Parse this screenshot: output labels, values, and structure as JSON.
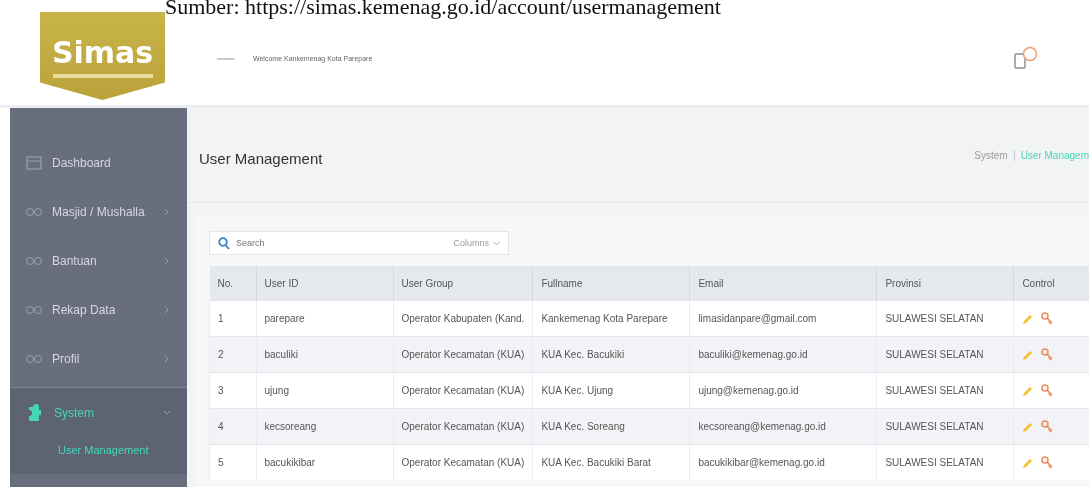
{
  "caption": "Sumber: https://simas.kemenag.go.id/account/usermanagement",
  "logo": {
    "text": "Simas"
  },
  "header": {
    "welcome": "Welcome Kankemenag Kota Parepare"
  },
  "sidebar": {
    "items": [
      {
        "label": "Dashboard",
        "has_children": false,
        "selected": false
      },
      {
        "label": "Masjid / Mushalla",
        "has_children": true,
        "selected": false
      },
      {
        "label": "Bantuan",
        "has_children": true,
        "selected": false
      },
      {
        "label": "Rekap Data",
        "has_children": true,
        "selected": false
      },
      {
        "label": "Profil",
        "has_children": true,
        "selected": false
      },
      {
        "label": "System",
        "has_children": true,
        "selected": true,
        "expanded": true,
        "children": [
          {
            "label": "User Management",
            "selected": true
          }
        ]
      }
    ]
  },
  "page": {
    "title": "User Management",
    "breadcrumb": [
      {
        "label": "System",
        "selected": false
      },
      {
        "label": "User Managem",
        "selected": true
      }
    ]
  },
  "search": {
    "placeholder": "Search"
  },
  "columns_button": "Columns",
  "table": {
    "columns": [
      "No.",
      "User ID",
      "User Group",
      "Fullname",
      "Email",
      "Provinsi",
      "Control"
    ],
    "rows": [
      [
        "1",
        "parepare",
        "Operator Kabupaten (Kand.",
        "Kankemenag Kota Parepare",
        "limasidanpare@gmail.com",
        "SULAWESI SELATAN"
      ],
      [
        "2",
        "baculiki",
        "Operator Kecamatan (KUA)",
        "KUA Kec. Bacukiki",
        "baculiki@kemenag.go.id",
        "SULAWESI SELATAN"
      ],
      [
        "3",
        "ujung",
        "Operator Kecamatan (KUA)",
        "KUA Kec. Ujung",
        "ujung@kemenag.go.id",
        "SULAWESI SELATAN"
      ],
      [
        "4",
        "kecsoreang",
        "Operator Kecamatan (KUA)",
        "KUA Kec. Soreang",
        "kecsoreang@kemenag.go.id",
        "SULAWESI SELATAN"
      ],
      [
        "5",
        "bacukikibar",
        "Operator Kecamatan (KUA)",
        "KUA Kec. Bacukiki Barat",
        "bacukikibar@kemenag.go.id",
        "SULAWESI SELATAN"
      ]
    ]
  }
}
